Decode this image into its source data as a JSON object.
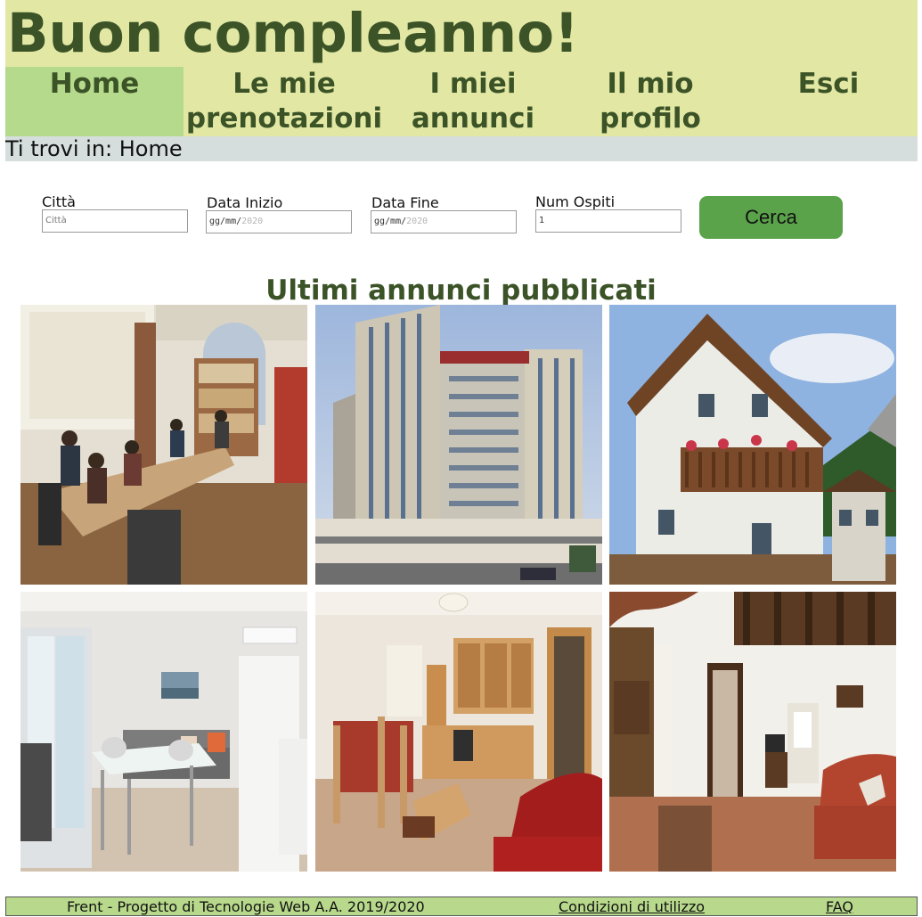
{
  "header": {
    "title": "Buon compleanno!"
  },
  "nav": {
    "items": [
      {
        "label_line1": "Home",
        "label_line2": "",
        "active": true
      },
      {
        "label_line1": "Le mie",
        "label_line2": "prenotazioni",
        "active": false
      },
      {
        "label_line1": "I miei",
        "label_line2": "annunci",
        "active": false
      },
      {
        "label_line1": "Il mio",
        "label_line2": "profilo",
        "active": false
      },
      {
        "label_line1": "Esci",
        "label_line2": "",
        "active": false
      }
    ]
  },
  "breadcrumb": {
    "text": "Ti trovi in: Home"
  },
  "search": {
    "city_label": "Città",
    "city_placeholder": "Città",
    "start_label": "Data Inizio",
    "start_value": "gg/mm/",
    "start_year": "2020",
    "end_label": "Data Fine",
    "end_value": "gg/mm/",
    "end_year": "2020",
    "guests_label": "Num Ospiti",
    "guests_value": "1",
    "button_label": "Cerca"
  },
  "listings": {
    "title": "Ultimi annunci pubblicati",
    "photos": [
      {
        "name": "study-room-photo"
      },
      {
        "name": "residence-tower-photo"
      },
      {
        "name": "alpine-chalet-photo"
      },
      {
        "name": "modern-living-room-photo"
      },
      {
        "name": "wooden-kitchen-photo"
      },
      {
        "name": "beamed-living-room-photo"
      }
    ]
  },
  "footer": {
    "text": "Frent - Progetto di Tecnologie Web A.A. 2019/2020",
    "terms_link": "Condizioni di utilizzo",
    "faq_link": "FAQ"
  },
  "colors": {
    "header_bg": "#e2e8a4",
    "title_green": "#3b5327",
    "nav_active_bg": "#b5da8c",
    "breadcrumb_bg": "#d5dedc",
    "button_green": "#5aa34a",
    "footer_bg": "#b8d98c"
  }
}
